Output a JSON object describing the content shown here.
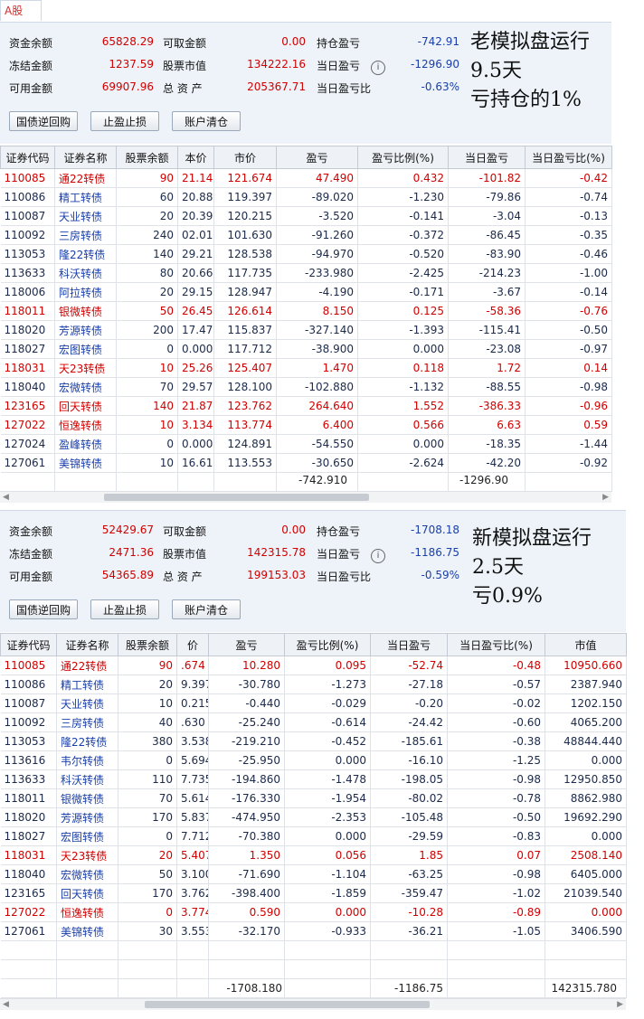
{
  "tab": {
    "label": "A股"
  },
  "panel1": {
    "info": {
      "labels": [
        "资金余额",
        "可取金额",
        "持仓盈亏",
        "冻结金额",
        "股票市值",
        "当日盈亏",
        "可用金额",
        "总 资 产",
        "当日盈亏比"
      ],
      "values": [
        "65828.29",
        "0.00",
        "-742.91",
        "1237.59",
        "134222.16",
        "-1296.90",
        "69907.96",
        "205367.71",
        "-0.63%"
      ]
    },
    "buttons": [
      "国债逆回购",
      "止盈止损",
      "账户清仓"
    ],
    "note": [
      "老模拟盘运行",
      "9.5天",
      "亏持仓的1%"
    ],
    "columns": [
      "证券代码",
      "证券名称",
      "股票余额",
      "本价",
      "市价",
      "盈亏",
      "盈亏比例(%)",
      "当日盈亏",
      "当日盈亏比(%)"
    ],
    "rows": [
      [
        "110085",
        "通22转债",
        "90",
        "21.146",
        "121.674",
        "47.490",
        "0.432",
        "-101.82",
        "-0.42"
      ],
      [
        "110086",
        "精工转债",
        "60",
        "20.881",
        "119.397",
        "-89.020",
        "-1.230",
        "-79.86",
        "-0.74"
      ],
      [
        "110087",
        "天业转债",
        "20",
        "20.391",
        "120.215",
        "-3.520",
        "-0.141",
        "-3.04",
        "-0.13"
      ],
      [
        "110092",
        "三房转债",
        "240",
        "02.010",
        "101.630",
        "-91.260",
        "-0.372",
        "-86.45",
        "-0.35"
      ],
      [
        "113053",
        "隆22转债",
        "140",
        "29.216",
        "128.538",
        "-94.970",
        "-0.520",
        "-83.90",
        "-0.46"
      ],
      [
        "113633",
        "科沃转债",
        "80",
        "20.660",
        "117.735",
        "-233.980",
        "-2.425",
        "-214.23",
        "-1.00"
      ],
      [
        "118006",
        "阿拉转债",
        "20",
        "29.157",
        "128.947",
        "-4.190",
        "-0.171",
        "-3.67",
        "-0.14"
      ],
      [
        "118011",
        "银微转债",
        "50",
        "26.451",
        "126.614",
        "8.150",
        "0.125",
        "-58.36",
        "-0.76"
      ],
      [
        "118020",
        "芳源转债",
        "200",
        "17.473",
        "115.837",
        "-327.140",
        "-1.393",
        "-115.41",
        "-0.50"
      ],
      [
        "118027",
        "宏图转债",
        "0",
        "0.000",
        "117.712",
        "-38.900",
        "0.000",
        "-23.08",
        "-0.97"
      ],
      [
        "118031",
        "天23转债",
        "10",
        "25.260",
        "125.407",
        "1.470",
        "0.118",
        "1.72",
        "0.14"
      ],
      [
        "118040",
        "宏微转债",
        "70",
        "29.570",
        "128.100",
        "-102.880",
        "-1.132",
        "-88.55",
        "-0.98"
      ],
      [
        "123165",
        "回天转债",
        "140",
        "21.872",
        "123.762",
        "264.640",
        "1.552",
        "-386.33",
        "-0.96"
      ],
      [
        "127022",
        "恒逸转债",
        "10",
        "3.134",
        "113.774",
        "6.400",
        "0.566",
        "6.63",
        "0.59"
      ],
      [
        "127024",
        "盈峰转债",
        "0",
        "0.000",
        "124.891",
        "-54.550",
        "0.000",
        "-18.35",
        "-1.44"
      ],
      [
        "127061",
        "美锦转债",
        "10",
        "16.618",
        "113.553",
        "-30.650",
        "-2.624",
        "-42.20",
        "-0.92"
      ]
    ],
    "red_rows": [
      0,
      7,
      10,
      12,
      13
    ],
    "totals": {
      "pnl": "-742.910",
      "day_pnl": "-1296.90"
    }
  },
  "panel2": {
    "info": {
      "labels": [
        "资金余额",
        "可取金额",
        "持仓盈亏",
        "冻结金额",
        "股票市值",
        "当日盈亏",
        "可用金额",
        "总 资 产",
        "当日盈亏比"
      ],
      "values": [
        "52429.67",
        "0.00",
        "-1708.18",
        "2471.36",
        "142315.78",
        "-1186.75",
        "54365.89",
        "199153.03",
        "-0.59%"
      ]
    },
    "buttons": [
      "国债逆回购",
      "止盈止损",
      "账户清仓"
    ],
    "note": [
      "新模拟盘运行",
      "2.5天",
      "亏0.9%"
    ],
    "columns": [
      "证券代码",
      "证券名称",
      "股票余额",
      "价",
      "盈亏",
      "盈亏比例(%)",
      "当日盈亏",
      "当日盈亏比(%)",
      "市值"
    ],
    "rows": [
      [
        "110085",
        "通22转债",
        "90",
        ".674",
        "10.280",
        "0.095",
        "-52.74",
        "-0.48",
        "10950.660"
      ],
      [
        "110086",
        "精工转债",
        "20",
        "9.397",
        "-30.780",
        "-1.273",
        "-27.18",
        "-0.57",
        "2387.940"
      ],
      [
        "110087",
        "天业转债",
        "10",
        "0.215",
        "-0.440",
        "-0.029",
        "-0.20",
        "-0.02",
        "1202.150"
      ],
      [
        "110092",
        "三房转债",
        "40",
        ".630",
        "-25.240",
        "-0.614",
        "-24.42",
        "-0.60",
        "4065.200"
      ],
      [
        "113053",
        "隆22转债",
        "380",
        "3.538",
        "-219.210",
        "-0.452",
        "-185.61",
        "-0.38",
        "48844.440"
      ],
      [
        "113616",
        "韦尔转债",
        "0",
        "5.694",
        "-25.950",
        "0.000",
        "-16.10",
        "-1.25",
        "0.000"
      ],
      [
        "113633",
        "科沃转债",
        "110",
        "7.735",
        "-194.860",
        "-1.478",
        "-198.05",
        "-0.98",
        "12950.850"
      ],
      [
        "118011",
        "银微转债",
        "70",
        "5.614",
        "-176.330",
        "-1.954",
        "-80.02",
        "-0.78",
        "8862.980"
      ],
      [
        "118020",
        "芳源转债",
        "170",
        "5.837",
        "-474.950",
        "-2.353",
        "-105.48",
        "-0.50",
        "19692.290"
      ],
      [
        "118027",
        "宏图转债",
        "0",
        "7.712",
        "-70.380",
        "0.000",
        "-29.59",
        "-0.83",
        "0.000"
      ],
      [
        "118031",
        "天23转债",
        "20",
        "5.407",
        "1.350",
        "0.056",
        "1.85",
        "0.07",
        "2508.140"
      ],
      [
        "118040",
        "宏微转债",
        "50",
        "3.100",
        "-71.690",
        "-1.104",
        "-63.25",
        "-0.98",
        "6405.000"
      ],
      [
        "123165",
        "回天转债",
        "170",
        "3.762",
        "-398.400",
        "-1.859",
        "-359.47",
        "-1.02",
        "21039.540"
      ],
      [
        "127022",
        "恒逸转债",
        "0",
        "3.774",
        "0.590",
        "0.000",
        "-10.28",
        "-0.89",
        "0.000"
      ],
      [
        "127061",
        "美锦转债",
        "30",
        "3.553",
        "-32.170",
        "-0.933",
        "-36.21",
        "-1.05",
        "3406.590"
      ]
    ],
    "red_rows": [
      0,
      10,
      13
    ],
    "totals": {
      "pnl": "-1708.180",
      "day_pnl": "-1186.75",
      "market": "142315.780"
    }
  },
  "colors": {
    "red": "#d00000",
    "blue": "#1a3fa8",
    "panel": "#edf3f8"
  }
}
